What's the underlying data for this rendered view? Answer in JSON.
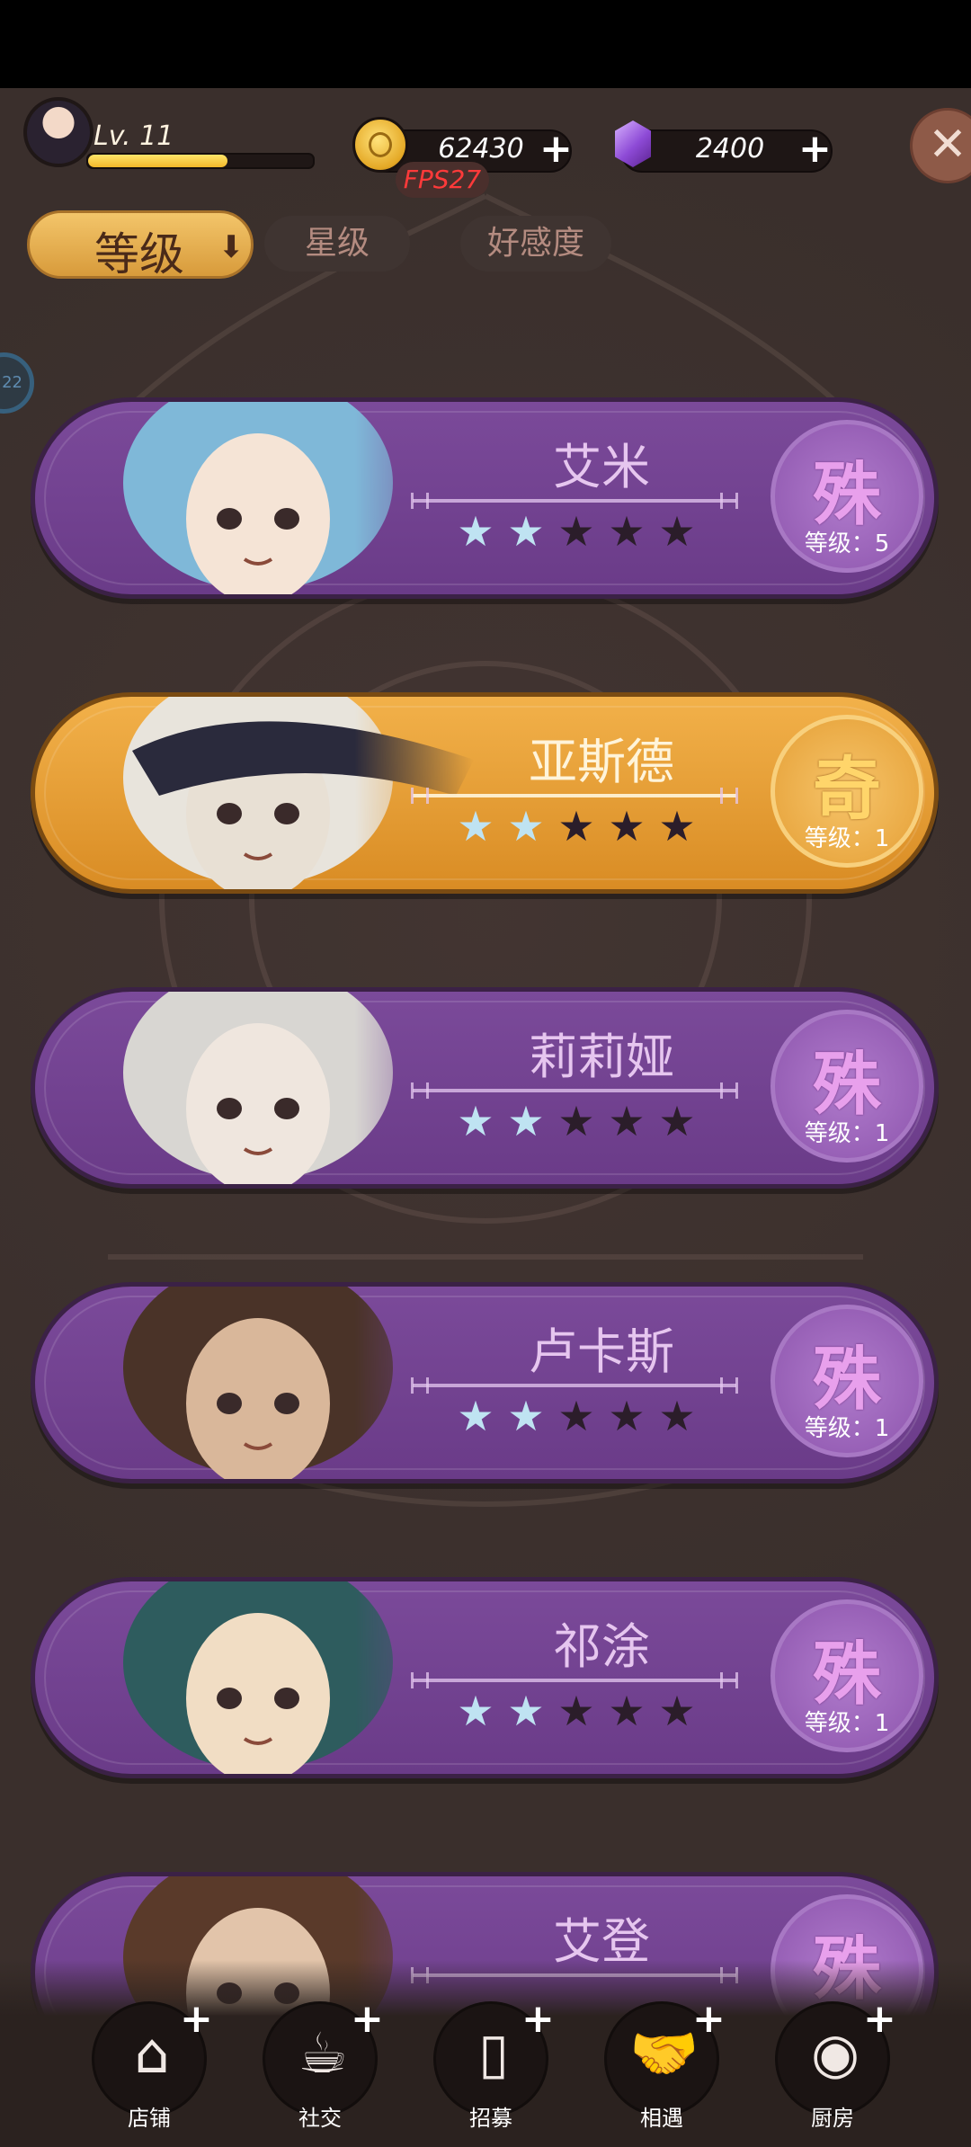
{
  "player": {
    "level_label": "Lv. 11",
    "xp_fraction": 0.62
  },
  "currency": {
    "coins": "62430",
    "gems": "2400",
    "plus": "+"
  },
  "debug": {
    "fps": "FPS27"
  },
  "close_label": "✕",
  "sort_tabs": {
    "active": {
      "label": "等级",
      "arrow": "⬇"
    },
    "star": "星级",
    "affection": "好感度"
  },
  "side_bubble": "22",
  "characters": [
    {
      "name": "艾米",
      "rank": "殊",
      "level_text": "等级：5",
      "stars_filled": 2,
      "stars_total": 5,
      "theme": "purple"
    },
    {
      "name": "亚斯德",
      "rank": "奇",
      "level_text": "等级：1",
      "stars_filled": 2,
      "stars_total": 5,
      "theme": "gold"
    },
    {
      "name": "莉莉娅",
      "rank": "殊",
      "level_text": "等级：1",
      "stars_filled": 2,
      "stars_total": 5,
      "theme": "purple"
    },
    {
      "name": "卢卡斯",
      "rank": "殊",
      "level_text": "等级：1",
      "stars_filled": 2,
      "stars_total": 5,
      "theme": "purple"
    },
    {
      "name": "祁涂",
      "rank": "殊",
      "level_text": "等级：1",
      "stars_filled": 2,
      "stars_total": 5,
      "theme": "purple"
    },
    {
      "name": "艾登",
      "rank": "殊",
      "level_text": "",
      "stars_filled": 0,
      "stars_total": 0,
      "theme": "purple"
    }
  ],
  "nav": [
    {
      "label": "店铺",
      "icon": "shop-icon"
    },
    {
      "label": "社交",
      "icon": "coffee-cup-icon"
    },
    {
      "label": "招募",
      "icon": "door-icon"
    },
    {
      "label": "相遇",
      "icon": "handshake-icon"
    },
    {
      "label": "厨房",
      "icon": "frying-pan-icon"
    }
  ]
}
